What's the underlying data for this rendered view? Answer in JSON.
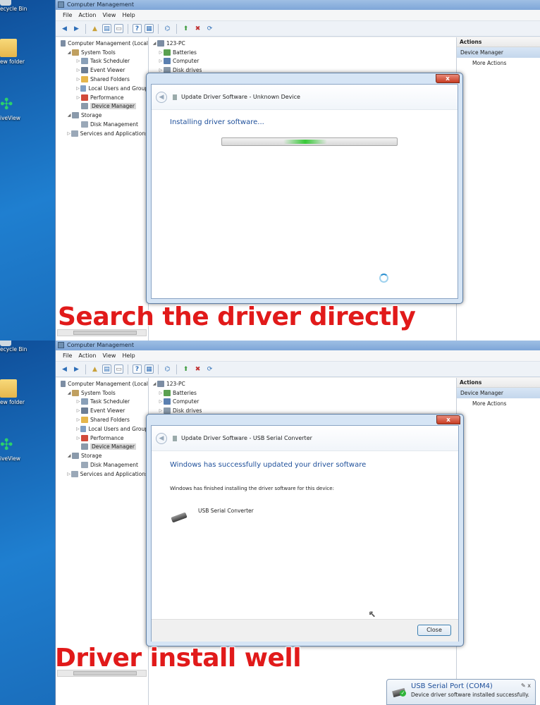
{
  "desktop": {
    "icons": [
      "ecycle Bin",
      "ew folder",
      "iveView"
    ]
  },
  "window": {
    "title": "Computer Management",
    "menu": [
      "File",
      "Action",
      "View",
      "Help"
    ]
  },
  "nav_tree": [
    {
      "label": "Computer Management (Local",
      "level": 0,
      "arrow": "",
      "icon": "computer-management-icon",
      "color": "#7c8da3"
    },
    {
      "label": "System Tools",
      "level": 1,
      "arrow": "◢",
      "icon": "tools-icon",
      "color": "#c0a060"
    },
    {
      "label": "Task Scheduler",
      "level": 2,
      "arrow": "▷",
      "icon": "clock-icon",
      "color": "#8aa0b8"
    },
    {
      "label": "Event Viewer",
      "level": 2,
      "arrow": "▷",
      "icon": "event-viewer-icon",
      "color": "#6c7e95"
    },
    {
      "label": "Shared Folders",
      "level": 2,
      "arrow": "▷",
      "icon": "shared-folder-icon",
      "color": "#e5b64c"
    },
    {
      "label": "Local Users and Group",
      "level": 2,
      "arrow": "▷",
      "icon": "users-icon",
      "color": "#7f9fc4"
    },
    {
      "label": "Performance",
      "level": 2,
      "arrow": "▷",
      "icon": "performance-icon",
      "color": "#d24a3a"
    },
    {
      "label": "Device Manager",
      "level": 2,
      "arrow": "",
      "icon": "device-manager-icon",
      "color": "#8a9aab",
      "selected": true
    },
    {
      "label": "Storage",
      "level": 1,
      "arrow": "◢",
      "icon": "storage-icon",
      "color": "#8a9aab"
    },
    {
      "label": "Disk Management",
      "level": 2,
      "arrow": "",
      "icon": "disk-icon",
      "color": "#9aa8b8"
    },
    {
      "label": "Services and Applications",
      "level": 1,
      "arrow": "▷",
      "icon": "services-icon",
      "color": "#9aa8b8"
    }
  ],
  "device_tree": [
    {
      "label": "123-PC",
      "arrow": "◢",
      "level": 0,
      "color": "#7c8da3"
    },
    {
      "label": "Batteries",
      "arrow": "▷",
      "level": 1,
      "color": "#5aa050"
    },
    {
      "label": "Computer",
      "arrow": "▷",
      "level": 1,
      "color": "#5a7fb0"
    },
    {
      "label": "Disk drives",
      "arrow": "▷",
      "level": 1,
      "color": "#8a9aab"
    }
  ],
  "actions_pane": {
    "header": "Actions",
    "section": "Device Manager",
    "item": "More Actions"
  },
  "dialog_top": {
    "title": "Update Driver Software - Unknown Device",
    "status": "Installing driver software...",
    "progress": 0.35,
    "close_glyph": "x"
  },
  "dialog_bottom": {
    "title": "Update Driver Software - USB Serial Converter",
    "heading": "Windows has successfully updated your driver software",
    "message": "Windows has finished installing the driver software for this device:",
    "device_name": "USB Serial Converter",
    "close_button": "Close",
    "close_glyph": "x"
  },
  "captions": {
    "top": "Search the driver directly",
    "bottom": "Driver install well"
  },
  "notification": {
    "title": "USB Serial Port (COM4)",
    "body": "Device driver software installed successfully.",
    "buttons": "✎  x"
  },
  "colors": {
    "caption_red": "#e11a1a",
    "heading_blue": "#1e4f9a",
    "progress_green": "#38c938"
  }
}
